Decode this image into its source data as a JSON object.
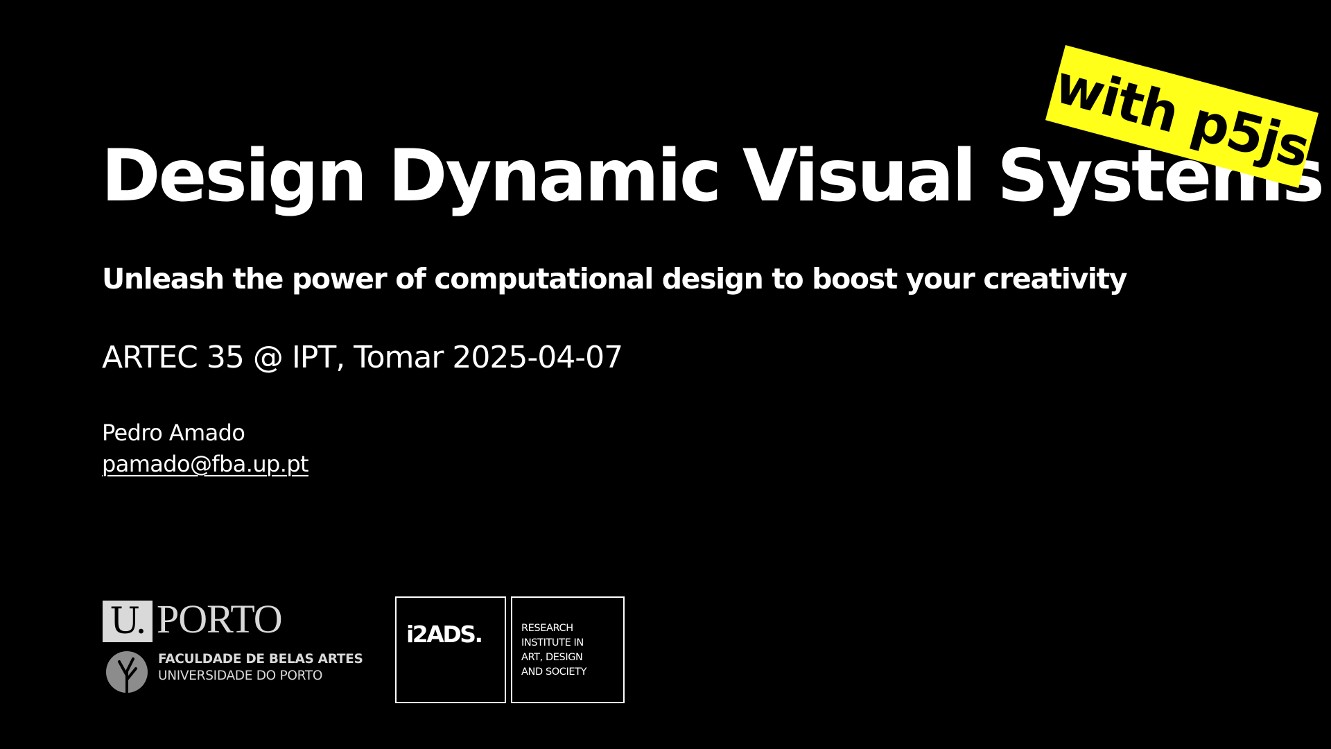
{
  "slide": {
    "title": "Design Dynamic Visual Systems",
    "sticker": "with p5js",
    "subtitle": "Unleash the power of computational design to boost your creativity",
    "event": "ARTEC 35 @ IPT, Tomar 2025-04-07",
    "author": "Pedro Amado",
    "email": "pamado@fba.up.pt"
  },
  "logos": {
    "uporto": {
      "mark": "U.",
      "word": "PORTO",
      "faculty_line1": "FACULDADE DE BELAS ARTES",
      "faculty_line2": "UNIVERSIDADE DO PORTO"
    },
    "i2ads": {
      "mark": "i2ADS.",
      "desc_lines": [
        "RESEARCH",
        "INSTITUTE IN",
        "ART, DESIGN",
        "AND SOCIETY"
      ]
    }
  },
  "colors": {
    "background": "#000000",
    "text": "#ffffff",
    "sticker": "#ffff1a",
    "logo_grey": "#d9d9d9"
  }
}
